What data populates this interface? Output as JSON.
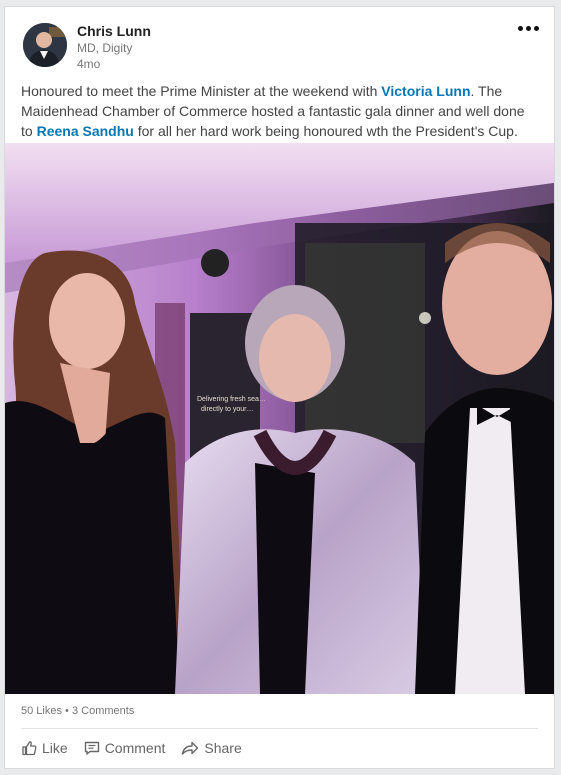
{
  "post": {
    "author_name": "Chris Lunn",
    "author_title": "MD, Digity",
    "age": "4mo",
    "text_part1": "Honoured to meet the Prime Minister at the weekend with ",
    "mention1": "Victoria Lunn",
    "text_part2": ". The Maidenhead Chamber of Commerce hosted a fantastic gala dinner and well done to ",
    "mention2": "Reena Sandhu",
    "text_part3": " for all her hard work being honoured wth the President's Cup.",
    "photo_sign_text": "Delivering fresh sea… directly to your…"
  },
  "engagement": {
    "likes": "50 Likes",
    "separator": "•",
    "comments": "3 Comments"
  },
  "actions": {
    "like": "Like",
    "comment": "Comment",
    "share": "Share"
  },
  "colors": {
    "link": "#0a77b5",
    "muted": "#777777"
  }
}
